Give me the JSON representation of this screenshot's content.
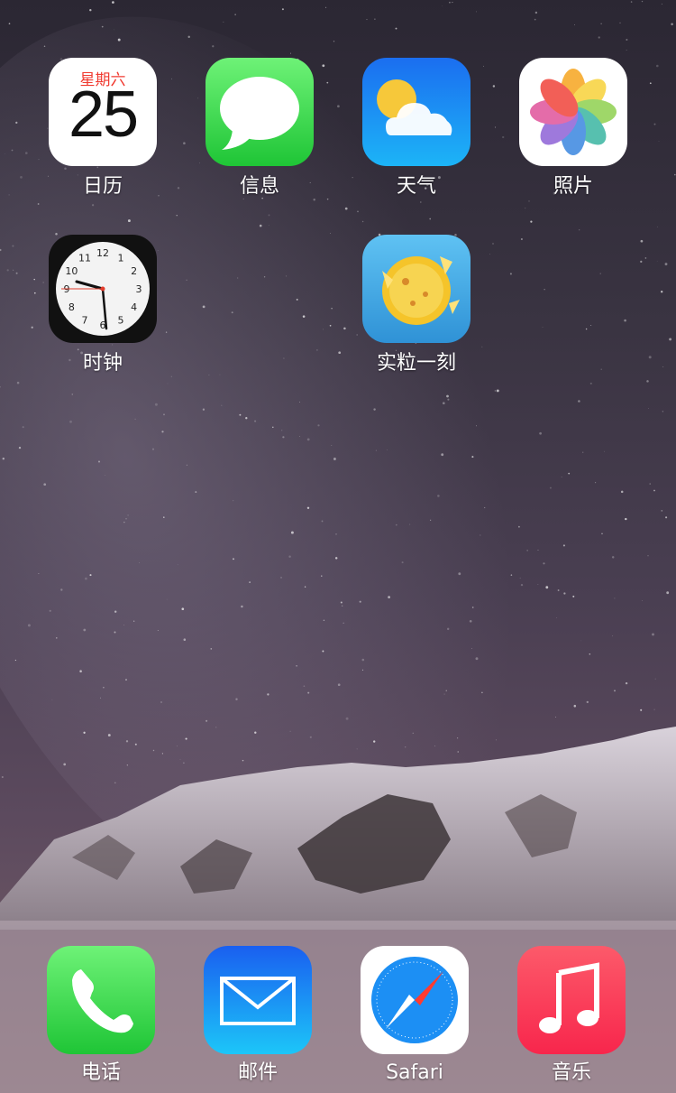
{
  "home": {
    "apps": [
      {
        "label": "日历"
      },
      {
        "label": "信息"
      },
      {
        "label": "天气"
      },
      {
        "label": "照片"
      },
      {
        "label": "时钟"
      },
      {
        "label": "实粒一刻"
      }
    ],
    "calendar": {
      "weekday": "星期六",
      "date": "25"
    },
    "clock_numbers": [
      "12",
      "1",
      "2",
      "3",
      "4",
      "5",
      "6",
      "7",
      "8",
      "9",
      "10",
      "11"
    ]
  },
  "dock": {
    "apps": [
      {
        "label": "电话"
      },
      {
        "label": "邮件"
      },
      {
        "label": "Safari"
      },
      {
        "label": "音乐"
      }
    ]
  },
  "colors": {
    "messages": "#3ddc47",
    "weather": "#1a8ff5",
    "phone": "#38d348",
    "mail": "#1c8ff4",
    "music": "#fb3a55",
    "calendar_red": "#f03a30"
  }
}
